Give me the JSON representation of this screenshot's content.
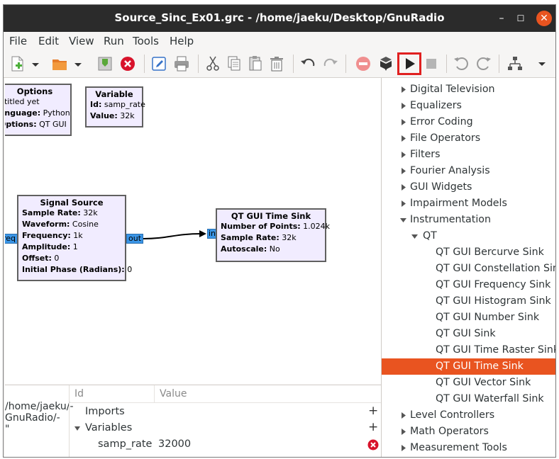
{
  "window": {
    "title": "Source_Sinc_Ex01.grc - /home/jaeku/Desktop/GnuRadio",
    "minimize": "–",
    "maximize": "☐",
    "close": "✕"
  },
  "menubar": [
    "File",
    "Edit",
    "View",
    "Run",
    "Tools",
    "Help"
  ],
  "toolbar": {
    "icons": [
      "new-icon",
      "new-dropdown-icon",
      "open-icon",
      "open-dropdown-icon",
      "save-icon",
      "close-icon",
      "edit-icon",
      "print-icon",
      "cut-icon",
      "copy-icon",
      "paste-icon",
      "delete-icon",
      "undo-icon",
      "redo-icon",
      "errors-icon",
      "generate-icon",
      "execute-icon",
      "kill-icon",
      "rotate-ccw-icon",
      "rotate-cw-icon",
      "find-block-icon",
      "more-icon"
    ],
    "highlight": "execute-icon",
    "highlight_color": "#e02020"
  },
  "blocks": {
    "options": {
      "title": "Options",
      "rows": [
        {
          "key": "",
          "val": "ntitled yet"
        },
        {
          "key": "anguage:",
          "val": " Python"
        },
        {
          "key": " Options:",
          "val": " QT GUI"
        }
      ]
    },
    "variable": {
      "title": "Variable",
      "rows": [
        {
          "key": "Id:",
          "val": " samp_rate"
        },
        {
          "key": "Value:",
          "val": " 32k"
        }
      ]
    },
    "signal_source": {
      "title": "Signal Source",
      "rows": [
        {
          "key": "Sample Rate:",
          "val": " 32k"
        },
        {
          "key": "Waveform:",
          "val": " Cosine"
        },
        {
          "key": "Frequency:",
          "val": " 1k"
        },
        {
          "key": "Amplitude:",
          "val": " 1"
        },
        {
          "key": "Offset:",
          "val": " 0"
        },
        {
          "key": "Initial Phase (Radians):",
          "val": " 0"
        }
      ],
      "in_port": "req",
      "out_port": "out"
    },
    "time_sink": {
      "title": "QT GUI Time Sink",
      "rows": [
        {
          "key": "Number of Points:",
          "val": " 1.024k"
        },
        {
          "key": "Sample Rate:",
          "val": " 32k"
        },
        {
          "key": "Autoscale:",
          "val": " No"
        }
      ],
      "in_port": "in"
    }
  },
  "console": {
    "lines": [
      "/home/jaeku/-",
      "GnuRadio/-",
      "\""
    ]
  },
  "variables_panel": {
    "col_id": "Id",
    "col_value": "Value",
    "imports": "Imports",
    "variables": "Variables",
    "rows": [
      {
        "id": "samp_rate",
        "value": "32000"
      }
    ],
    "add_symbol": "+"
  },
  "block_tree": {
    "items": [
      {
        "label": "Digital Television",
        "level": 0,
        "expander": "collapsed"
      },
      {
        "label": "Equalizers",
        "level": 0,
        "expander": "collapsed"
      },
      {
        "label": "Error Coding",
        "level": 0,
        "expander": "collapsed"
      },
      {
        "label": "File Operators",
        "level": 0,
        "expander": "collapsed"
      },
      {
        "label": "Filters",
        "level": 0,
        "expander": "collapsed"
      },
      {
        "label": "Fourier Analysis",
        "level": 0,
        "expander": "collapsed"
      },
      {
        "label": "GUI Widgets",
        "level": 0,
        "expander": "collapsed"
      },
      {
        "label": "Impairment Models",
        "level": 0,
        "expander": "collapsed"
      },
      {
        "label": "Instrumentation",
        "level": 0,
        "expander": "expanded"
      },
      {
        "label": "QT",
        "level": 1,
        "expander": "expanded"
      },
      {
        "label": "QT GUI Bercurve Sink",
        "level": 2,
        "expander": "none"
      },
      {
        "label": "QT GUI Constellation Sink",
        "level": 2,
        "expander": "none"
      },
      {
        "label": "QT GUI Frequency Sink",
        "level": 2,
        "expander": "none"
      },
      {
        "label": "QT GUI Histogram Sink",
        "level": 2,
        "expander": "none"
      },
      {
        "label": "QT GUI Number Sink",
        "level": 2,
        "expander": "none"
      },
      {
        "label": "QT GUI Sink",
        "level": 2,
        "expander": "none"
      },
      {
        "label": "QT GUI Time Raster Sink",
        "level": 2,
        "expander": "none"
      },
      {
        "label": "QT GUI Time Sink",
        "level": 2,
        "expander": "none",
        "selected": true
      },
      {
        "label": "QT GUI Vector Sink",
        "level": 2,
        "expander": "none"
      },
      {
        "label": "QT GUI Waterfall Sink",
        "level": 2,
        "expander": "none"
      },
      {
        "label": "Level Controllers",
        "level": 0,
        "expander": "collapsed"
      },
      {
        "label": "Math Operators",
        "level": 0,
        "expander": "collapsed"
      },
      {
        "label": "Measurement Tools",
        "level": 0,
        "expander": "collapsed"
      }
    ],
    "selected_color": "#e95420"
  }
}
